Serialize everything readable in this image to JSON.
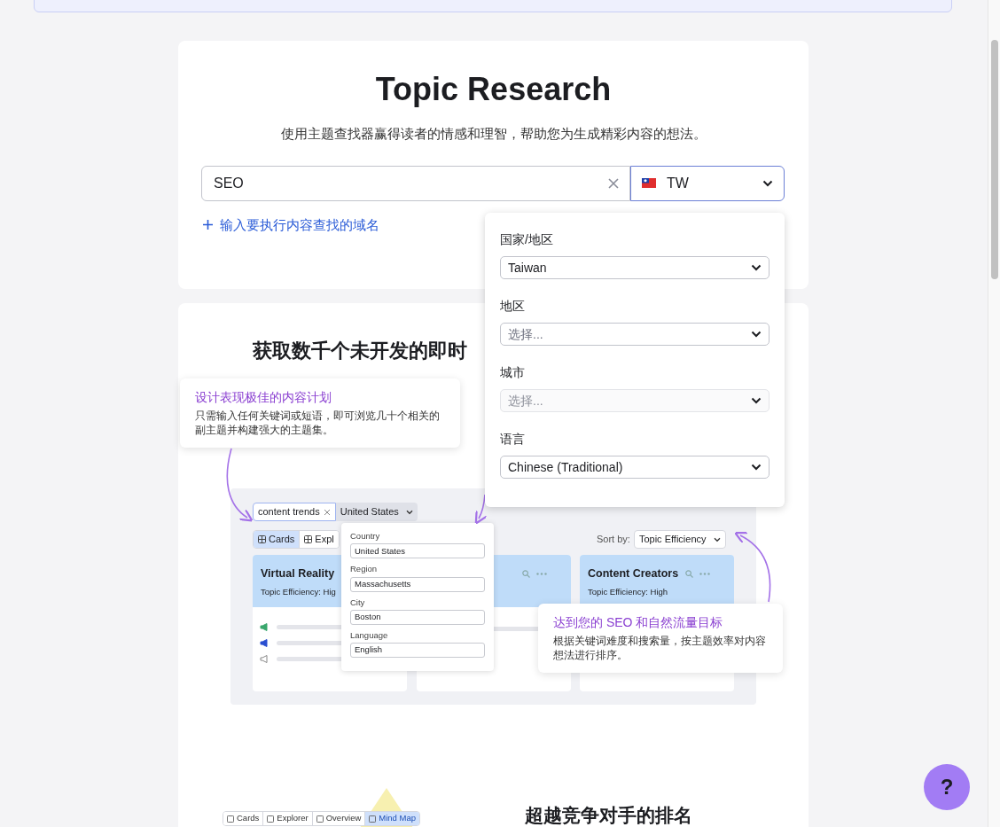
{
  "header": {
    "title": "Topic Research",
    "subtitle": "使用主题查找器赢得读者的情感和理智，帮助您为生成精彩内容的想法。"
  },
  "search": {
    "value": "SEO",
    "country": "TW",
    "add_domain": "输入要执行内容查找的域名"
  },
  "location_dropdown": {
    "fields": [
      {
        "label": "国家/地区",
        "value": "Taiwan",
        "disabled": false
      },
      {
        "label": "地区",
        "placeholder": "选择...",
        "disabled": false
      },
      {
        "label": "城市",
        "placeholder": "选择...",
        "disabled": true
      },
      {
        "label": "语言",
        "value": "Chinese (Traditional)",
        "disabled": false
      }
    ]
  },
  "feature": {
    "heading": "获取数千个未开发的即时",
    "callouts": [
      {
        "title": "设计表现极佳的内容计划",
        "body": "只需输入任何关键词或短语，即可浏览几十个相关的副主题并构建强大的主题集。"
      },
      {
        "title": "达到您的 SEO 和自然流量目标",
        "body": "根据关键词难度和搜索量，按主题效率对内容想法进行排序。"
      }
    ],
    "mockup": {
      "keyword": "content trends",
      "country": "United States",
      "view_tabs": [
        {
          "label": "Cards",
          "selected": true
        },
        {
          "label": "Expl",
          "selected": false
        }
      ],
      "sort_label": "Sort by:",
      "sort_value": "Topic Efficiency",
      "popup_fields": [
        {
          "label": "Country",
          "value": "United States"
        },
        {
          "label": "Region",
          "value": "Massachusetts"
        },
        {
          "label": "City",
          "value": "Boston"
        },
        {
          "label": "Language",
          "value": "English"
        }
      ],
      "cards": [
        {
          "title": "Virtual Reality",
          "subtitle": "Topic Efficiency: Hig"
        },
        {
          "title": "Content Creators",
          "subtitle": "Topic Efficiency: High"
        }
      ]
    }
  },
  "next_feature": {
    "view_tabs": [
      {
        "label": "Cards",
        "selected": false
      },
      {
        "label": "Explorer",
        "selected": false
      },
      {
        "label": "Overview",
        "selected": false
      },
      {
        "label": "Mind Map",
        "selected": true
      }
    ],
    "heading": "超越竞争对手的排名"
  },
  "help_button": "?"
}
